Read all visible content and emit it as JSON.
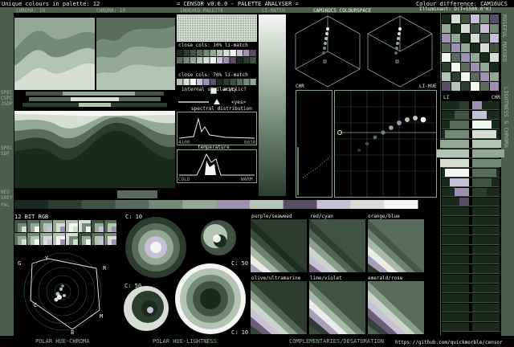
{
  "header": {
    "unique_colours": "Unique colours in palette: 12",
    "app_title": "= CENSOR v0.6.0 - PALETTE ANALYSER =",
    "colour_difference": "Colour difference: CAM16UCS",
    "illuminant": "Illuminant: D(T=5500.0°K)",
    "chroma_label": "CHROMA: 10",
    "chroma2_label": "CHROMA: 10",
    "indexed_palette": "INDEXED PALETTE",
    "li_match": "LI-MATCH"
  },
  "left_labels": {
    "spec": "SPEC",
    "cspc": "CSPC",
    "jsdp": "JSDP",
    "spec2": "SPEC",
    "sdp": "SDP",
    "neu": "NEU",
    "grey": "GREY",
    "pal": "PAL",
    "bit_rgb": "12 BIT RGB"
  },
  "indexed": {
    "close_cols_1": "close cols: 10% li-match",
    "close_cols_2": "close cols: 70% li-match",
    "internal_similarity": "internal similarity",
    "acyclic": "acyclic?",
    "yes": "<yes>",
    "spectral_distribution": "spectral distribution",
    "spec_min": "4100",
    "spec_max": "6650",
    "temperature": "temperature",
    "cold": "COLD",
    "warm": "WARM"
  },
  "cam": {
    "title": "CAM16UCS COLOURSPACE",
    "chr": "CHR",
    "li_hue": "LI-HUE"
  },
  "right": {
    "side_label": "ROSEFUL MAXXED",
    "li": "LI",
    "chr": "CHR",
    "side_label2": "LIGHTNESS & CHROMA"
  },
  "circles": {
    "c_top": "C: 10",
    "c_50a": "C: 50",
    "c_50b": "C: 50",
    "c_10b": "C: 10"
  },
  "complementaries": {
    "pairs": [
      "purple/seaweed",
      "red/cyan",
      "orange/blue",
      "olive/ultramarine",
      "lime/violet",
      "emerald/rose"
    ]
  },
  "polar": {
    "labels": [
      "G",
      "Y",
      "R",
      "C",
      "M",
      "B"
    ]
  },
  "footer": {
    "polar_hue_chroma": "POLAR HUE-CHROMA",
    "polar_hue_lightness": "POLAR HUE-LIGHTNESS",
    "complementaries_desat": "COMPLEMENTARIES/DESATURATION",
    "github": "https://github.com/quickmorble/censor"
  },
  "palette": [
    "#1a2a1e",
    "#2c3d30",
    "#3f5243",
    "#586b5c",
    "#748a78",
    "#93a895",
    "#b4c4b4",
    "#d6ded6",
    "#f4f6f4",
    "#c8c0d6",
    "#9e90b0",
    "#5a4e66"
  ],
  "colors": {
    "frame": "#495e4e",
    "frame_dark": "#2d3b30",
    "border": "#8fa58f",
    "text": "#e8f0e8",
    "accent": "#f0f0ff"
  }
}
